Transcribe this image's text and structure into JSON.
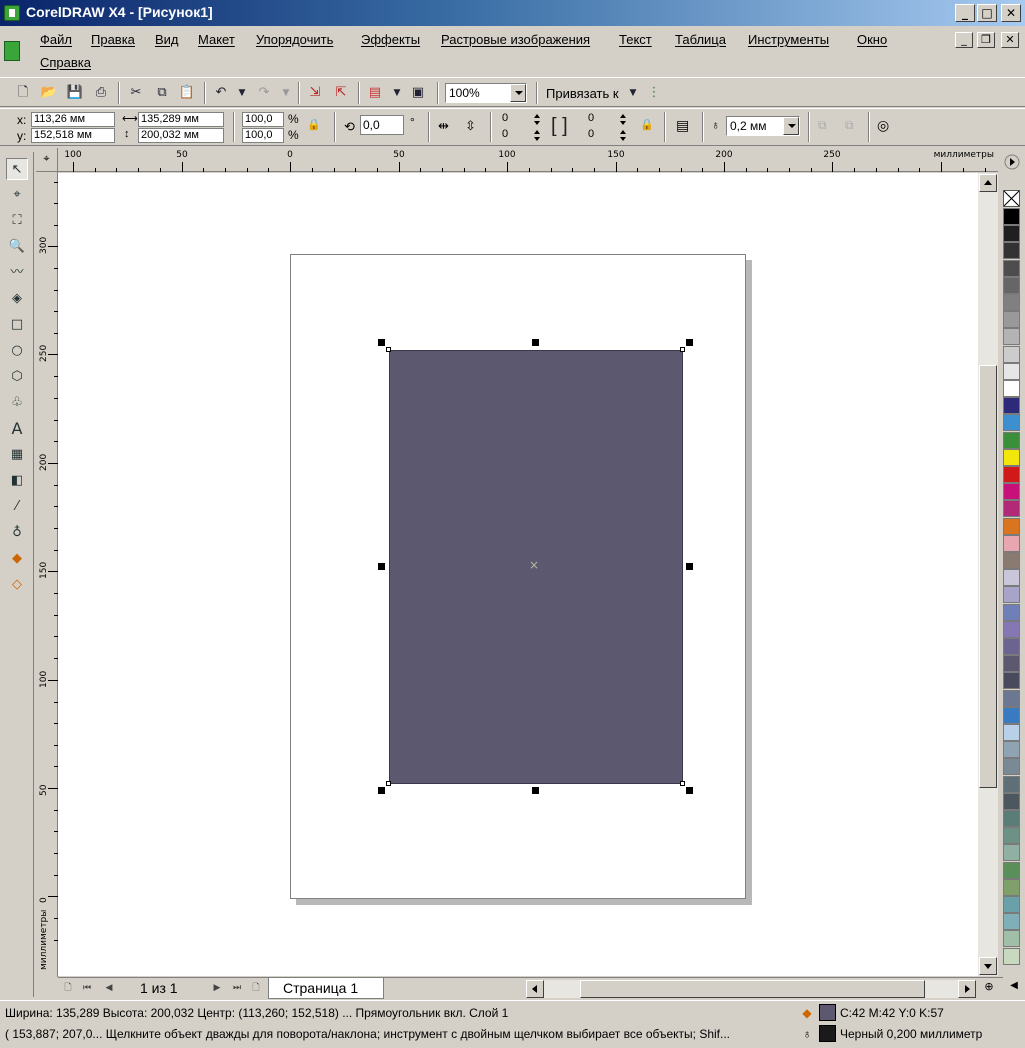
{
  "window": {
    "title": "CorelDRAW X4 - [Рисунок1]"
  },
  "menu": {
    "items": [
      "Файл",
      "Правка",
      "Вид",
      "Макет",
      "Упорядочить",
      "Эффекты",
      "Растровые изображения",
      "Текст",
      "Таблица",
      "Инструменты",
      "Окно",
      "Справка"
    ]
  },
  "toolbar": {
    "zoom": "100%",
    "snap_label": "Привязать к"
  },
  "properties": {
    "x_label": "x:",
    "y_label": "y:",
    "x_value": "113,26 мм",
    "y_value": "152,518 мм",
    "width_value": "135,289 мм",
    "height_value": "200,032 мм",
    "scale_x": "100,0",
    "scale_y": "100,0",
    "percent": "%",
    "rotation": "0,0",
    "degree": "°",
    "corner_tl": "0",
    "corner_bl": "0",
    "corner_tr": "0",
    "corner_br": "0",
    "outline_width": "0,2 мм"
  },
  "ruler": {
    "unit": "миллиметры",
    "h_ticks": [
      "100",
      "50",
      "0",
      "50",
      "100",
      "150",
      "200",
      "250"
    ],
    "v_ticks": [
      "300",
      "250",
      "200",
      "150",
      "100",
      "50",
      "0"
    ]
  },
  "page_nav": {
    "counter": "1 из 1",
    "tab_label": "Страница 1"
  },
  "status": {
    "line1": "Ширина: 135,289  Высота: 200,032  Центр: (113,260; 152,518)  ...   Прямоугольник вкл. Слой 1",
    "line2": "( 153,887; 207,0...  Щелкните объект дважды для поворота/наклона; инструмент с двойным щелчком выбирает все объекты; Shif...",
    "fill_text": "C:42 M:42 Y:0 K:57",
    "outline_text": "Черный   0,200 миллиметр",
    "fill_color": "#5c586f",
    "outline_color": "#1a1a1a"
  },
  "colors": {
    "rectangle_fill": "#5c586f",
    "title_gradient_start": "#0a246a"
  },
  "palette": [
    "#000000",
    "#1f1f1f",
    "#333333",
    "#4d4d4d",
    "#666666",
    "#808080",
    "#999999",
    "#b3b3b3",
    "#cccccc",
    "#e6e6e6",
    "#ffffff",
    "#2e2a7a",
    "#3d8fd0",
    "#3b8f3b",
    "#f2e60a",
    "#d01a1a",
    "#c7107a",
    "#b02a78",
    "#d9741f",
    "#e8a7b0",
    "#8a7b72",
    "#c9c6d9",
    "#a8a3c9",
    "#6f7fb8",
    "#8477b3",
    "#6b6491",
    "#5c586f",
    "#4a4a5e",
    "#6c7891",
    "#3a7ac0",
    "#b8d0e8",
    "#8fa3b3",
    "#7a8a94",
    "#5f6f78",
    "#4c5760",
    "#5a7d78",
    "#6e9185",
    "#8fb0a3",
    "#5a8f5a",
    "#7fa06b",
    "#6aa0a8",
    "#7fb0b8",
    "#9fbfa8",
    "#c9d9c0"
  ]
}
